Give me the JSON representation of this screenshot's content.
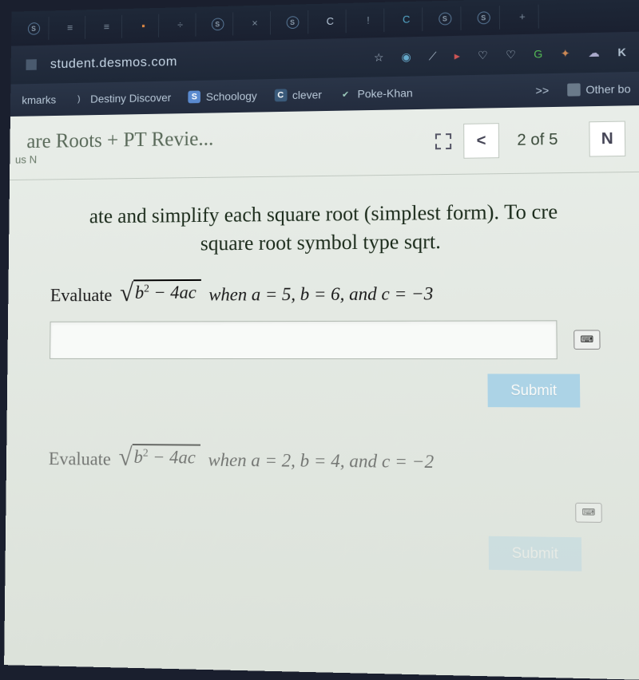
{
  "browser": {
    "tabs": [
      "S",
      "≡",
      "≡",
      "·",
      "÷",
      "S",
      "×",
      "S",
      "C",
      "!",
      "C",
      "S",
      "S",
      "+"
    ],
    "url": "student.desmos.com",
    "url_right": [
      "☆",
      "◎",
      "⟋",
      "⟩",
      "▽",
      "♡",
      "G",
      "⚙",
      "☁",
      "K"
    ]
  },
  "bookmarks": {
    "prefix": "kmarks",
    "items": [
      {
        "label": "Destiny Discover"
      },
      {
        "label": "Schoology"
      },
      {
        "label": "clever"
      },
      {
        "label": "Poke-Khan"
      }
    ],
    "overflow": ">>",
    "other": "Other bo"
  },
  "header": {
    "title": "are Roots + PT Revie...",
    "subtitle": "us N",
    "nav_prev": "<",
    "nav_count": "2 of 5",
    "nav_next": "N"
  },
  "instruction": {
    "line1": "ate and simplify each square root (simplest form). To cre",
    "line2": "square root symbol type sqrt."
  },
  "problems": [
    {
      "prompt_prefix": "Evaluate",
      "radicand_html": "b² − 4ac",
      "when": "when a = 5, b = 6, and c = −3",
      "submit": "Submit"
    },
    {
      "prompt_prefix": "Evaluate",
      "radicand_html": "b² − 4ac",
      "when": "when a = 2, b = 4, and c = −2",
      "submit": "Submit"
    }
  ]
}
